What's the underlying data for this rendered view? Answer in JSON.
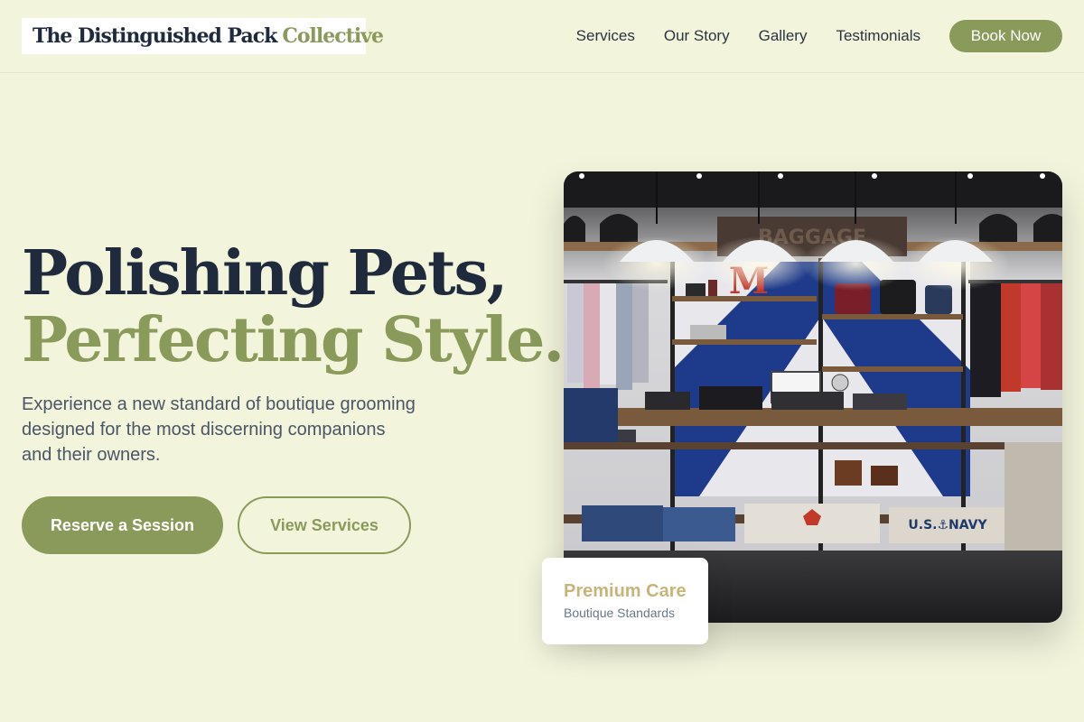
{
  "header": {
    "logo": {
      "part1": "The Distinguished Pack",
      "part2": "Collective"
    },
    "nav": [
      "Services",
      "Our Story",
      "Gallery",
      "Testimonials"
    ],
    "cta": "Book Now"
  },
  "hero": {
    "title_line1": "Polishing Pets,",
    "title_line2": "Perfecting Style.",
    "subtitle": "Experience a new standard of boutique grooming designed for the most discerning companions and their owners.",
    "primary_button": "Reserve a Session",
    "secondary_button": "View Services"
  },
  "photo": {
    "signs": {
      "big_letter": "M",
      "shirt_text": "U.S.⚓NAVY",
      "top_sign": "BAGGAGE"
    }
  },
  "badge": {
    "title": "Premium Care",
    "subtitle": "Boutique Standards"
  },
  "colors": {
    "background": "#f3f4dc",
    "accent": "#8a9a5b",
    "heading": "#1f2a3c",
    "gold": "#c8b47a"
  }
}
